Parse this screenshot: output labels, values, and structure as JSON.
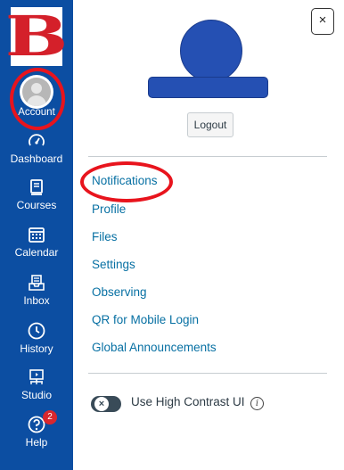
{
  "sidebar": {
    "logo_letter": "B",
    "account_label": "Account",
    "items": [
      {
        "label": "Dashboard",
        "icon": "dashboard-icon"
      },
      {
        "label": "Courses",
        "icon": "courses-icon"
      },
      {
        "label": "Calendar",
        "icon": "calendar-icon"
      },
      {
        "label": "Inbox",
        "icon": "inbox-icon"
      },
      {
        "label": "History",
        "icon": "history-icon"
      },
      {
        "label": "Studio",
        "icon": "studio-icon"
      },
      {
        "label": "Help",
        "icon": "help-icon"
      }
    ],
    "help_badge": "2"
  },
  "tray": {
    "close_label": "×",
    "logout_label": "Logout",
    "links": [
      "Notifications",
      "Profile",
      "Files",
      "Settings",
      "Observing",
      "QR for Mobile Login",
      "Global Announcements"
    ],
    "toggle_knob": "×",
    "toggle_label": "Use High Contrast UI",
    "info_glyph": "i"
  },
  "colors": {
    "sidebar": "#0c4ea2",
    "link": "#0770a3",
    "highlight_oval": "#e8141d",
    "redaction": "#2550b3"
  }
}
